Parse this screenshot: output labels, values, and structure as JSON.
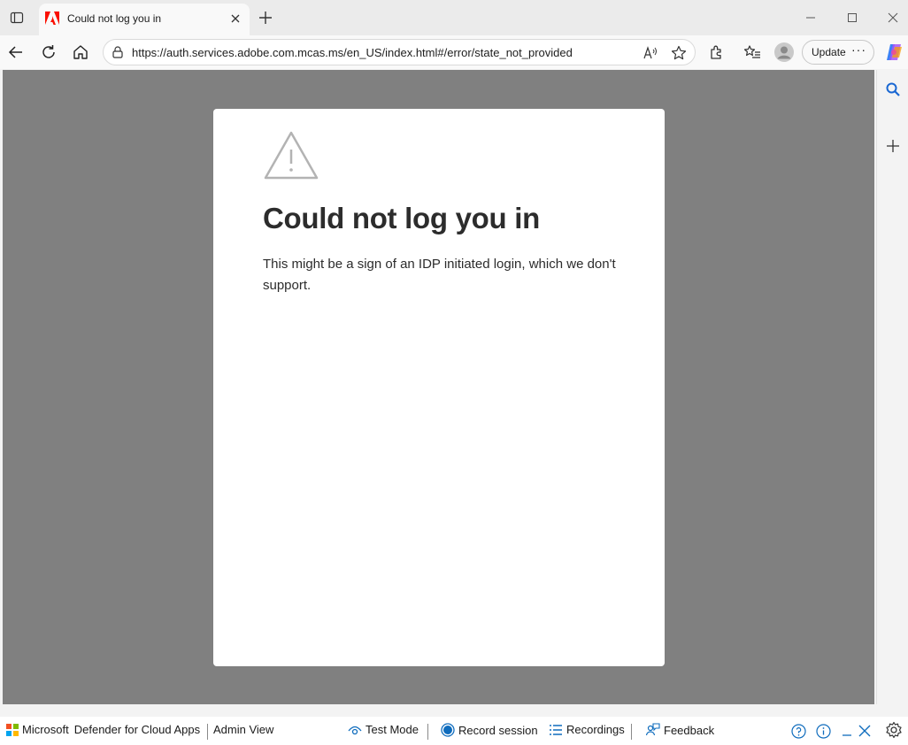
{
  "colors": {
    "adobe_red": "#fa0f00",
    "page_bg": "#808080",
    "accent_blue": "#0f6cbd"
  },
  "browser": {
    "tab": {
      "title": "Could not log you in",
      "favicon": "adobe-icon"
    },
    "address": {
      "url": "https://auth.services.adobe.com.mcas.ms/en_US/index.html#/error/state_not_provided"
    },
    "update_label": "Update",
    "more_label": "···"
  },
  "page": {
    "title": "Could not log you in",
    "message": "This might be a sign of an IDP initiated login, which we don't support."
  },
  "mcas_bar": {
    "brand_microsoft": "Microsoft",
    "brand_product": "Defender for Cloud Apps",
    "admin_view": "Admin View",
    "test_mode": "Test Mode",
    "record_session": "Record session",
    "recordings": "Recordings",
    "feedback": "Feedback"
  }
}
